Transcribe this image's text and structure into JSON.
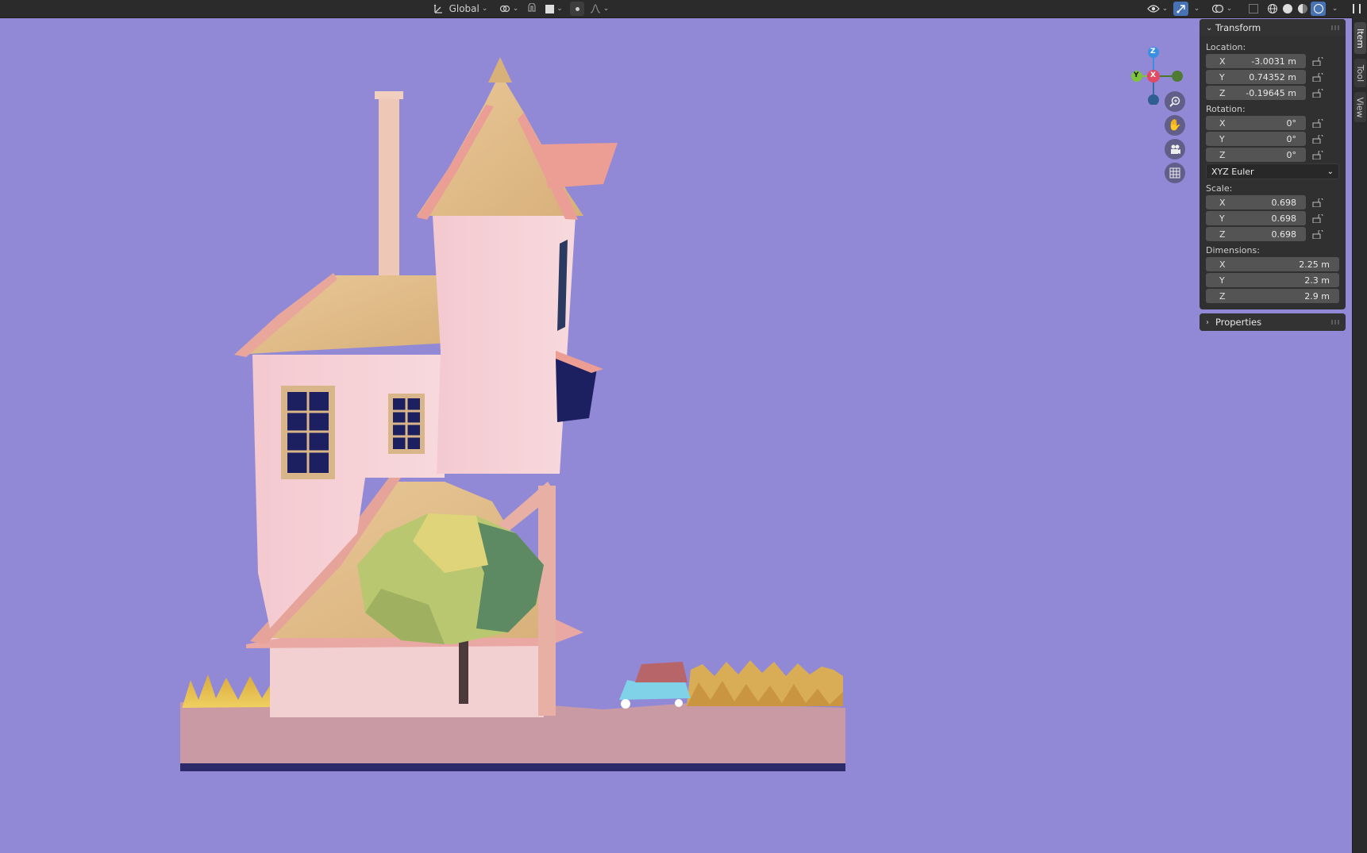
{
  "header": {
    "orientation_label": "Global",
    "items": [
      "transform-orientation-icon",
      "pivot-icon",
      "snap-icon",
      "proportional-icon"
    ]
  },
  "n_panel_tabs": [
    "Item",
    "Tool",
    "View"
  ],
  "transform": {
    "title": "Transform",
    "location_label": "Location:",
    "location": [
      {
        "axis": "X",
        "value": "-3.0031 m"
      },
      {
        "axis": "Y",
        "value": "0.74352 m"
      },
      {
        "axis": "Z",
        "value": "-0.19645 m"
      }
    ],
    "rotation_label": "Rotation:",
    "rotation": [
      {
        "axis": "X",
        "value": "0°"
      },
      {
        "axis": "Y",
        "value": "0°"
      },
      {
        "axis": "Z",
        "value": "0°"
      }
    ],
    "rotation_mode": "XYZ Euler",
    "scale_label": "Scale:",
    "scale": [
      {
        "axis": "X",
        "value": "0.698"
      },
      {
        "axis": "Y",
        "value": "0.698"
      },
      {
        "axis": "Z",
        "value": "0.698"
      }
    ],
    "dimensions_label": "Dimensions:",
    "dimensions": [
      {
        "axis": "X",
        "value": "2.25 m"
      },
      {
        "axis": "Y",
        "value": "2.3 m"
      },
      {
        "axis": "Z",
        "value": "2.9 m"
      }
    ]
  },
  "properties": {
    "title": "Properties"
  },
  "gizmo": {
    "z": "Z",
    "y": "Y",
    "x": "X"
  },
  "colors": {
    "viewport_bg": "#9289d6",
    "accent": "#4772b3",
    "panel": "#303030",
    "field": "#545454"
  }
}
